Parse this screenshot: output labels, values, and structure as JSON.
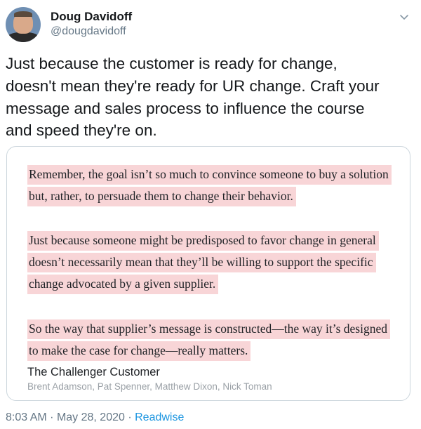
{
  "author": {
    "name": "Doug Davidoff",
    "handle": "@dougdavidoff"
  },
  "tweet": {
    "lines": [
      "Just because the customer is ready for change,",
      "doesn't mean they're ready for UR change. Craft your",
      "message and sales process to influence the course",
      "and speed they're on."
    ]
  },
  "highlight_card": {
    "quotes": [
      "Remember, the goal isn’t so much to convince someone to buy a solution but, rather, to persuade them to change their behavior.",
      "Just because someone might be predisposed to favor change in general doesn’t necessarily mean that they’ll be willing to support the specific change advocated by a given supplier.",
      "So the way that supplier’s message is constructed—the way it’s designed to make the case for change—really matters."
    ],
    "book_title": "The Challenger Customer",
    "book_authors": "Brent Adamson, Pat Spenner, Matthew Dixon, Nick Toman",
    "highlight_color": "#f8d5d7"
  },
  "meta": {
    "time": "8:03 AM",
    "separator": "·",
    "date": "May 28, 2020",
    "source": "Readwise"
  },
  "icons": {
    "menu": "chevron-down-icon",
    "avatar": "avatar"
  },
  "colors": {
    "link": "#1b95e0",
    "secondary_text": "#657786",
    "border": "#ccd6dd"
  }
}
